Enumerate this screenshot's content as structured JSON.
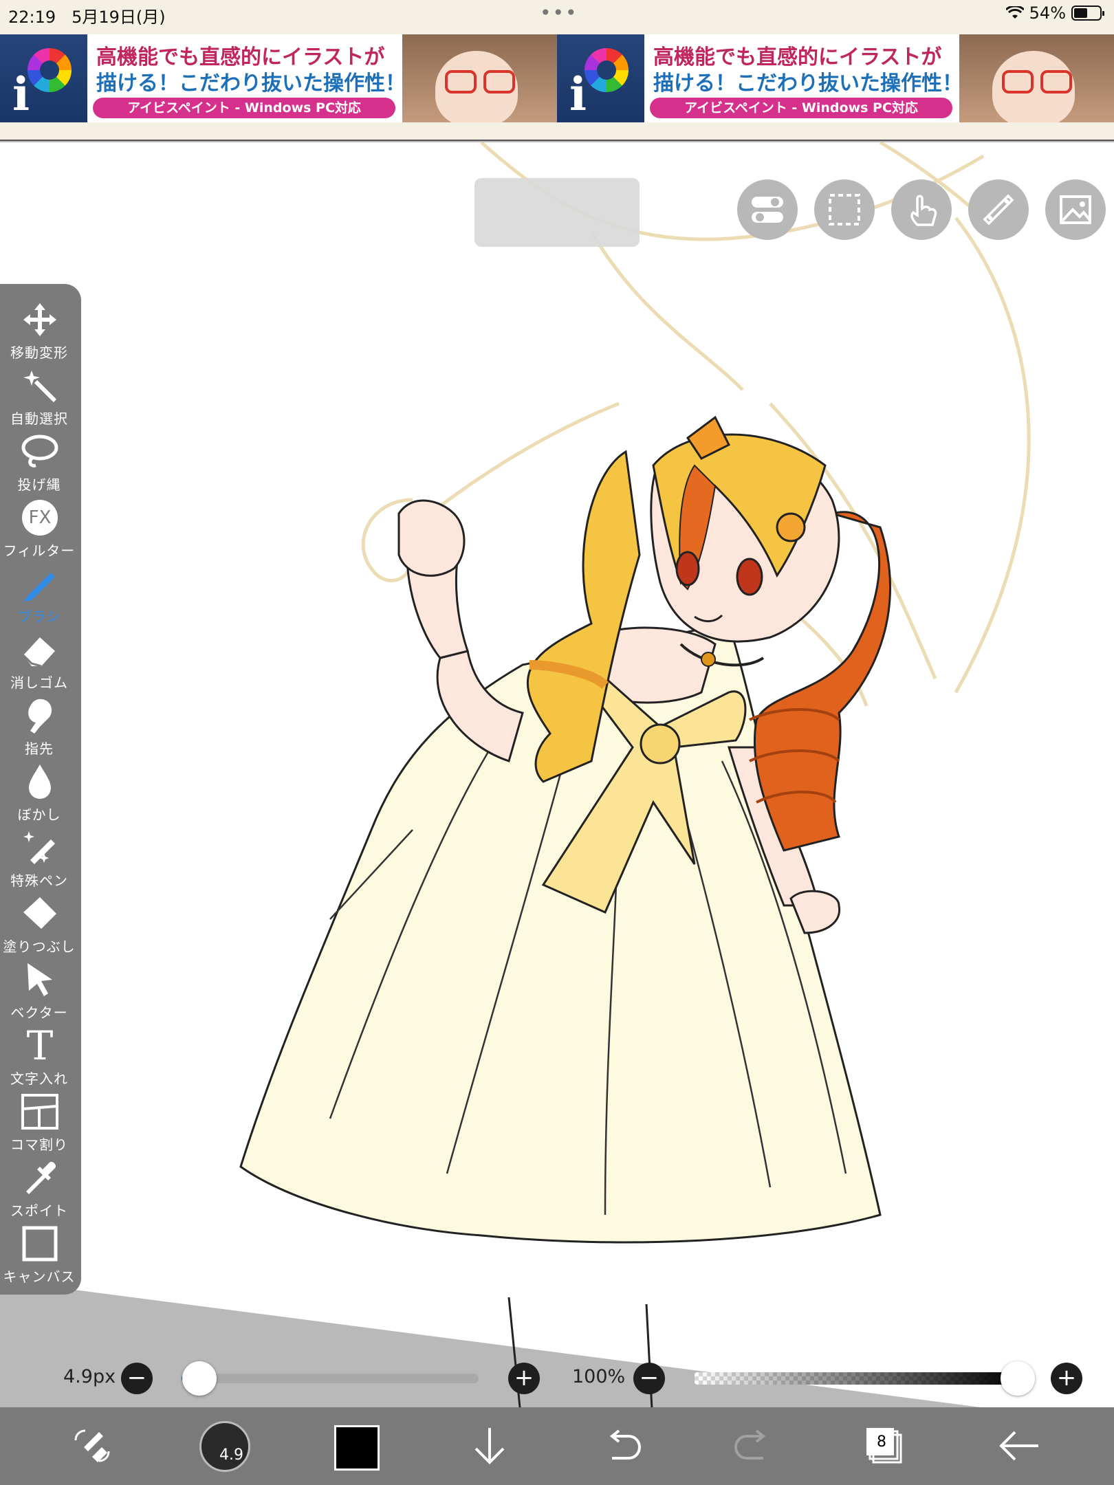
{
  "status_bar": {
    "time": "22:19",
    "date": "5月19日(月)",
    "battery": "54%",
    "battery_level": 0.54
  },
  "ads": [
    {
      "line1": "高機能でも直感的にイラストが",
      "line2": "描ける！こだわり抜いた操作性！",
      "pill": "アイビスペイント - Windows PC対応"
    },
    {
      "line1": "高機能でも直感的にイラストが",
      "line2": "描ける！こだわり抜いた操作性！",
      "pill": "アイビスペイント - Windows PC対応"
    }
  ],
  "top_buttons": [
    {
      "name": "toggle-icon"
    },
    {
      "name": "selection-icon"
    },
    {
      "name": "touch-icon"
    },
    {
      "name": "ruler-icon"
    },
    {
      "name": "image-icon"
    }
  ],
  "tools": [
    {
      "label": "移動変形",
      "icon": "move-icon"
    },
    {
      "label": "自動選択",
      "icon": "magic-wand-icon"
    },
    {
      "label": "投げ縄",
      "icon": "lasso-icon"
    },
    {
      "label": "フィルター",
      "icon": "fx-icon",
      "glyph": "FX"
    },
    {
      "label": "ブラシ",
      "icon": "brush-icon",
      "active": true
    },
    {
      "label": "消しゴム",
      "icon": "eraser-icon"
    },
    {
      "label": "指先",
      "icon": "finger-icon"
    },
    {
      "label": "ぼかし",
      "icon": "blur-icon"
    },
    {
      "label": "特殊ペン",
      "icon": "special-pen-icon"
    },
    {
      "label": "塗りつぶし",
      "icon": "fill-icon"
    },
    {
      "label": "ベクター",
      "icon": "vector-icon"
    },
    {
      "label": "文字入れ",
      "icon": "text-icon",
      "glyph": "T"
    },
    {
      "label": "コマ割り",
      "icon": "frame-icon"
    },
    {
      "label": "スポイト",
      "icon": "eyedropper-icon"
    },
    {
      "label": "キャンバス",
      "icon": "canvas-icon"
    }
  ],
  "brush": {
    "size_label": "4.9px",
    "size_fraction": 0.06,
    "opacity_label": "100%",
    "opacity_fraction": 1.0
  },
  "bottom_bar": {
    "brush_badge": "4.9",
    "layers_count": "8",
    "color": "#000000"
  },
  "accent_color": "#2f8ae8"
}
